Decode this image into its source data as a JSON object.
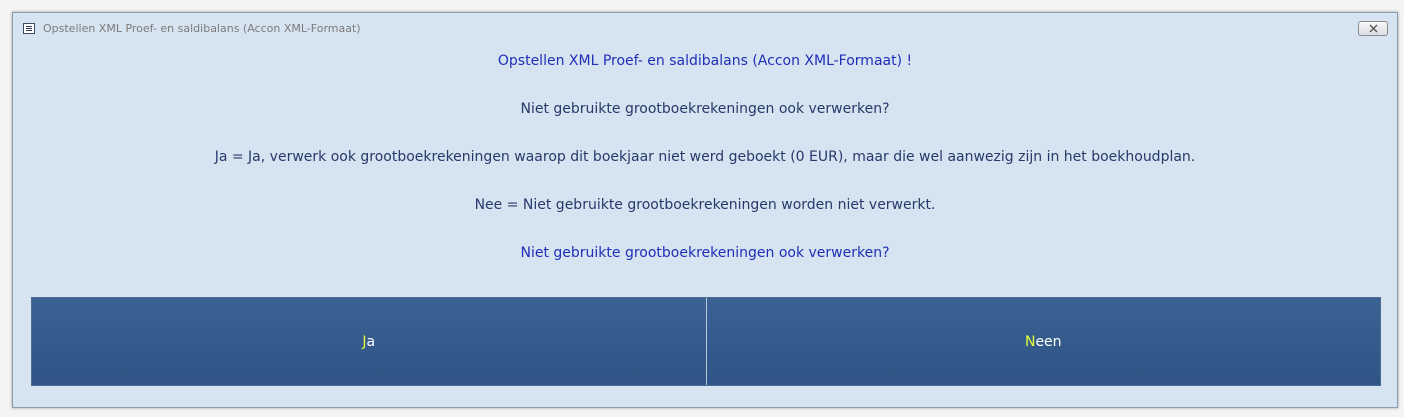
{
  "window": {
    "title": "Opstellen XML Proef- en saldibalans (Accon XML-Formaat)",
    "close_icon": "close-icon"
  },
  "messages": {
    "heading": "Opstellen XML Proef- en saldibalans (Accon XML-Formaat) !",
    "question": "Niet gebruikte grootboekrekeningen ook verwerken?",
    "yes_explanation": "Ja = Ja, verwerk ook grootboekrekeningen waarop dit boekjaar niet werd geboekt (0 EUR), maar die wel aanwezig zijn in het boekhoudplan.",
    "no_explanation": "Nee = Niet gebruikte grootboekrekeningen worden niet verwerkt.",
    "question_repeat": "Niet gebruikte grootboekrekeningen ook verwerken?"
  },
  "buttons": {
    "yes": {
      "hotkey": "J",
      "rest": "a"
    },
    "no": {
      "hotkey": "N",
      "rest": "een"
    }
  },
  "colors": {
    "background": "#d6e3f1",
    "button": "#345a8b",
    "hotkey": "#e6ff3a",
    "heading_text": "#1f2fb8",
    "body_text": "#27396a"
  }
}
